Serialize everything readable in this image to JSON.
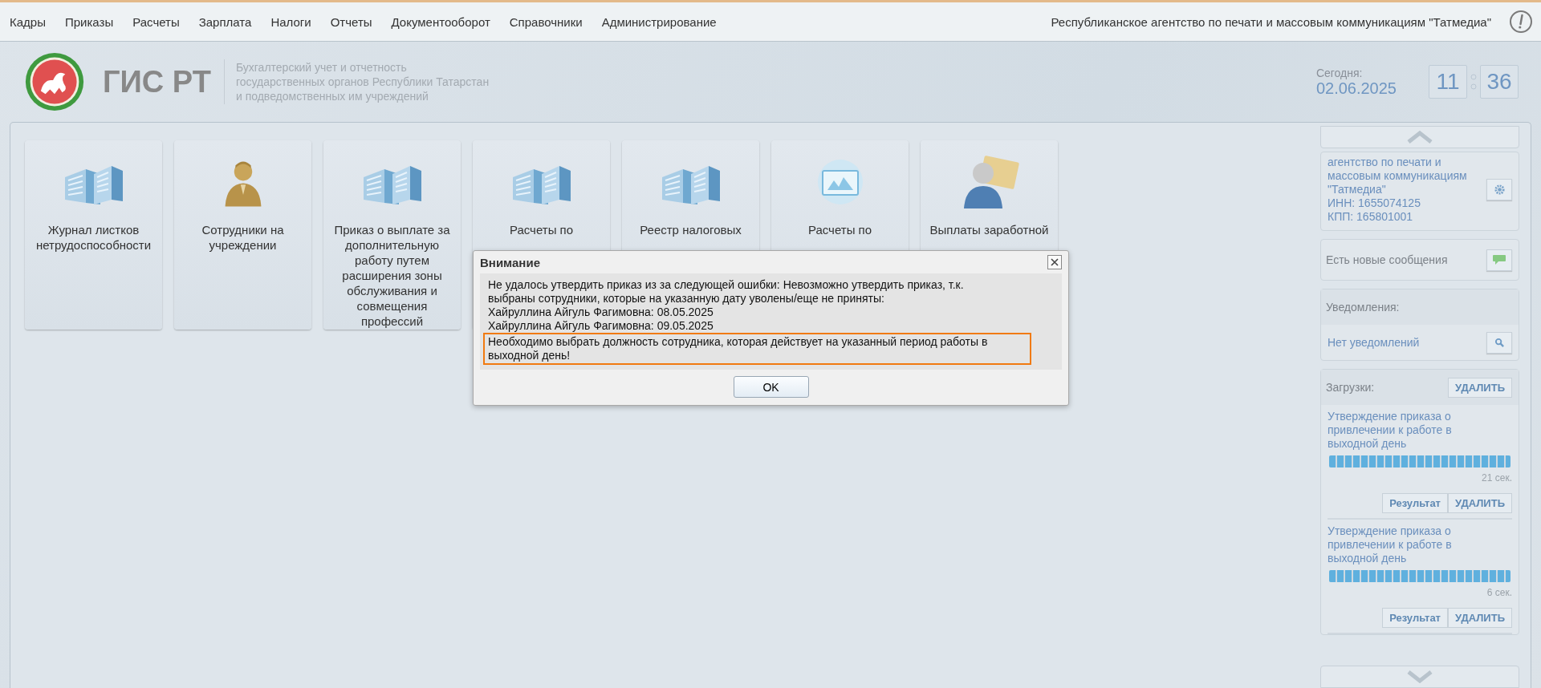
{
  "menu": {
    "items": [
      "Кадры",
      "Приказы",
      "Расчеты",
      "Зарплата",
      "Налоги",
      "Отчеты",
      "Документооборот",
      "Справочники",
      "Администрирование"
    ],
    "organization": "Республиканское агентство по печати и массовым коммуникациям \"Татмедиа\""
  },
  "header": {
    "product_title": "ГИС РТ",
    "subtitle_lines": [
      "Бухгалтерский учет и отчетность",
      "государственных органов Республики Татарстан",
      "и подведомственных им учреждений"
    ],
    "today_label": "Сегодня:",
    "date": "02.06.2025",
    "hours": "11",
    "minutes": "36"
  },
  "tiles": [
    {
      "kind": "building",
      "label": "Журнал листков нетрудоспособности"
    },
    {
      "kind": "person",
      "label": "Сотрудники на учреждении"
    },
    {
      "kind": "building",
      "label": "Приказ о выплате за дополнительную работу путем расширения зоны обслуживания и совмещения профессий"
    },
    {
      "kind": "building",
      "label": "Расчеты по"
    },
    {
      "kind": "building",
      "label": "Реестр налоговых"
    },
    {
      "kind": "certificate",
      "label": "Расчеты по"
    },
    {
      "kind": "user",
      "label": "Выплаты заработной"
    }
  ],
  "dialog": {
    "title": "Внимание",
    "message": "Не удалось утвердить приказ из за следующей ошибки: Невозможно утвердить приказ, т.к. выбраны сотрудники, которые на указанную дату уволены/еще не приняты:",
    "lines": [
      {
        "text": "Хайруллина Айгуль Фагимовна: 08.05.2025",
        "highlighted": false
      },
      {
        "text": "Хайруллина Айгуль Фагимовна: 09.05.2025",
        "highlighted": false
      },
      {
        "text": "Необходимо выбрать должность сотрудника, которая действует на указанный период работы в выходной день!",
        "highlighted": true
      }
    ],
    "button": "OK"
  },
  "sidebar": {
    "organization_lines": [
      "агентство по печати и",
      "массовым коммуникациям",
      "\"Татмедиа\"",
      "ИНН: 1655074125",
      "КПП: 165801001"
    ],
    "messages": "Есть новые сообщения",
    "notifications": {
      "title": "Уведомления:",
      "text": "Нет уведомлений"
    },
    "downloads": {
      "title": "Загрузки:",
      "delete_button": "УДАЛИТЬ",
      "items": [
        {
          "title": "Утверждение приказа о привлечении к работе в выходной день",
          "level": 1,
          "elapsed": "21 сек.",
          "result_button": "Результат",
          "delete_button": "УДАЛИТЬ"
        },
        {
          "title": "Утверждение приказа о привлечении к работе в выходной день",
          "level": 1,
          "elapsed": "6 сек.",
          "result_button": "Результат",
          "delete_button": "УДАЛИТЬ"
        }
      ]
    }
  }
}
